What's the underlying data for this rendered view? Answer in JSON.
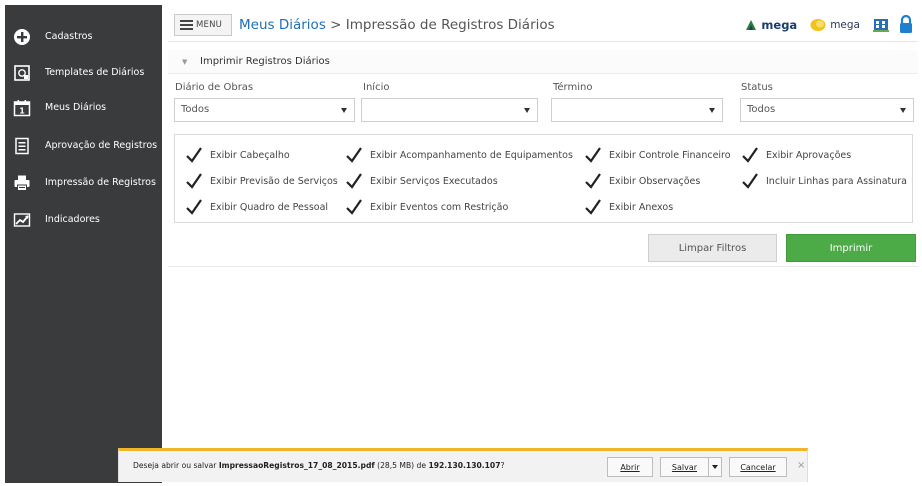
{
  "sidebar": {
    "items": [
      {
        "label": "Cadastros",
        "icon": "add-circle-icon"
      },
      {
        "label": "Templates de Diários",
        "icon": "document-image-icon"
      },
      {
        "label": "Meus Diários",
        "icon": "calendar-icon"
      },
      {
        "label": "Aprovação de Registros",
        "icon": "checklist-icon"
      },
      {
        "label": "Impressão de Registros",
        "icon": "printer-icon"
      },
      {
        "label": "Indicadores",
        "icon": "chart-icon"
      }
    ]
  },
  "header": {
    "menu_label": "MENU",
    "breadcrumb_link": "Meus Diários",
    "breadcrumb_separator": ">",
    "breadcrumb_current": "Impressão de Registros Diários",
    "logo1": "mega",
    "logo2": "mega"
  },
  "panel": {
    "title": "Imprimir Registros Diários"
  },
  "filters": {
    "diario": {
      "label": "Diário de Obras",
      "value": "Todos"
    },
    "inicio": {
      "label": "Início",
      "value": ""
    },
    "termino": {
      "label": "Término",
      "value": ""
    },
    "status": {
      "label": "Status",
      "value": "Todos"
    }
  },
  "options": [
    {
      "label": "Exibir Cabeçalho",
      "checked": true
    },
    {
      "label": "Exibir Acompanhamento de Equipamentos",
      "checked": true
    },
    {
      "label": "Exibir Controle Financeiro",
      "checked": true
    },
    {
      "label": "Exibir Aprovações",
      "checked": true
    },
    {
      "label": "Exibir Previsão de Serviços",
      "checked": true
    },
    {
      "label": "Exibir Serviços Executados",
      "checked": true
    },
    {
      "label": "Exibir Observações",
      "checked": true
    },
    {
      "label": "Incluir Linhas para Assinatura",
      "checked": true
    },
    {
      "label": "Exibir Quadro de Pessoal",
      "checked": true
    },
    {
      "label": "Exibir Eventos com Restrição",
      "checked": true
    },
    {
      "label": "Exibir Anexos",
      "checked": true
    }
  ],
  "actions": {
    "clear_label": "Limpar Filtros",
    "print_label": "Imprimir"
  },
  "download": {
    "prefix": "Deseja abrir ou salvar ",
    "filename": "ImpressaoRegistros_17_08_2015.pdf",
    "size": " (28,5 MB) de ",
    "host": "192.130.130.107",
    "suffix": "?",
    "open_label": "Abrir",
    "save_label": "Salvar",
    "cancel_label": "Cancelar",
    "close_glyph": "×"
  },
  "colors": {
    "sidebar_bg": "#3a3b3d",
    "link": "#1f6fb6",
    "print_button": "#4caa47",
    "download_accent": "#f0b429"
  }
}
